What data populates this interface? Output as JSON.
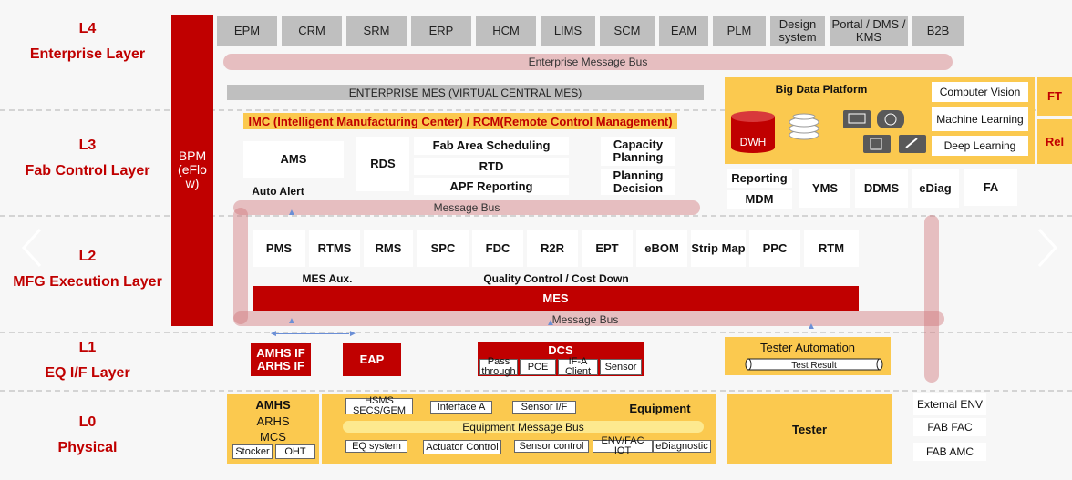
{
  "layers": {
    "l4": {
      "code": "L4",
      "name": "Enterprise Layer"
    },
    "l3": {
      "code": "L3",
      "name": "Fab Control Layer"
    },
    "l2": {
      "code": "L2",
      "name": "MFG Execution Layer"
    },
    "l1": {
      "code": "L1",
      "name": "EQ I/F Layer"
    },
    "l0": {
      "code": "L0",
      "name": "Physical"
    }
  },
  "bpm": {
    "line1": "BPM",
    "line2": "(eFlo",
    "line3": "w)"
  },
  "enterprise_apps": [
    "EPM",
    "CRM",
    "SRM",
    "ERP",
    "HCM",
    "LIMS",
    "SCM",
    "EAM",
    "PLM",
    "Design system",
    "Portal / DMS / KMS",
    "B2B"
  ],
  "enterprise_bus": "Enterprise Message Bus",
  "enterprise_mes": "ENTERPRISE MES (VIRTUAL CENTRAL MES)",
  "imc": "IMC (Intelligent Manufacturing Center) / RCM(Remote Control Management)",
  "big_data": {
    "title": "Big Data Platform",
    "dwh": "DWH",
    "ml": [
      "Computer Vision",
      "Machine Learning",
      "Deep Learning"
    ],
    "ft": "FT",
    "rel": "Rel"
  },
  "l3_items": {
    "ams": "AMS",
    "auto_alert": "Auto Alert",
    "rds": "RDS",
    "fab_area_scheduling": "Fab Area Scheduling",
    "rtd": "RTD",
    "apf": "APF Reporting",
    "capacity_planning": "Capacity Planning",
    "planning_decision": "Planning Decision",
    "reporting": "Reporting",
    "mdm": "MDM",
    "yms": "YMS",
    "ddms": "DDMS",
    "ediag": "eDiag",
    "fa": "FA"
  },
  "message_bus_top": "Message Bus",
  "l2_items": [
    "PMS",
    "RTMS",
    "RMS",
    "SPC",
    "FDC",
    "R2R",
    "EPT",
    "eBOM",
    "Strip Map",
    "PPC",
    "RTM"
  ],
  "mes_aux": "MES Aux.",
  "quality_control": "Quality Control / Cost Down",
  "mes": "MES",
  "message_bus_bottom": "Message Bus",
  "l1_items": {
    "amhs_if": "AMHS IF",
    "arhs_if": "ARHS IF",
    "eap": "EAP",
    "dcs": "DCS",
    "dcs_sub": [
      "Pass through",
      "PCE",
      "IF-A Client",
      "Sensor"
    ],
    "tester_automation": "Tester Automation",
    "test_result": "Test Result"
  },
  "l0_items": {
    "amhs": "AMHS",
    "arhs": "ARHS",
    "mcs": "MCS",
    "stocker": "Stocker",
    "oht": "OHT",
    "hsms": "HSMS SECS/GEM",
    "interface_a": "Interface A",
    "sensor_if": "Sensor I/F",
    "equipment": "Equipment",
    "eq_bus": "Equipment Message Bus",
    "eq_system": "EQ system",
    "actuator_control": "Actuator Control",
    "sensor_control": "Sensor control",
    "env_fac_iot": "ENV/FAC IOT",
    "ediagnostic": "eDiagnostic",
    "tester": "Tester",
    "external_env": "External ENV",
    "fab_fac": "FAB FAC",
    "fab_amc": "FAB AMC"
  },
  "colors": {
    "red": "#c00000",
    "yellow": "#fbc94f",
    "gray": "#bfbfbf",
    "bus": "#d1777d"
  }
}
